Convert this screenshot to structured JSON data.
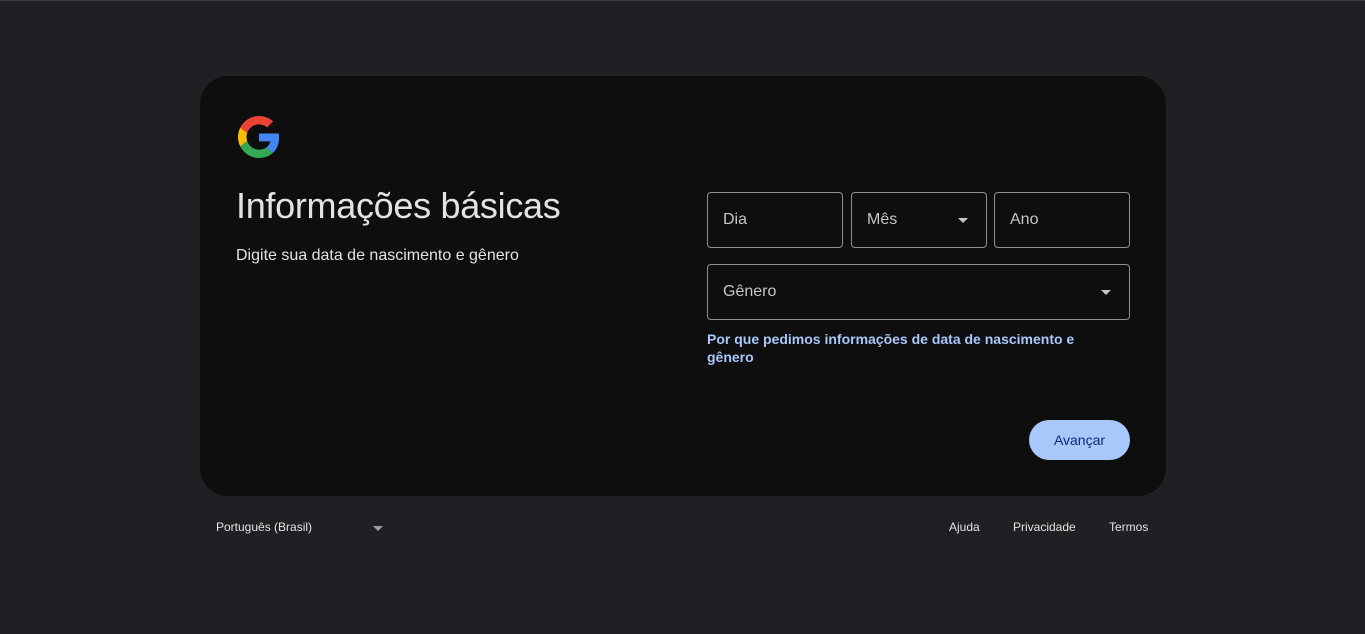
{
  "card": {
    "title": "Informações básicas",
    "subtitle": "Digite sua data de nascimento e gênero"
  },
  "form": {
    "day_placeholder": "Dia",
    "month_placeholder": "Mês",
    "year_placeholder": "Ano",
    "gender_placeholder": "Gênero",
    "why_link": "Por que pedimos informações de data de nascimento e gênero",
    "next_button": "Avançar"
  },
  "footer": {
    "language": "Português (Brasil)",
    "help": "Ajuda",
    "privacy": "Privacidade",
    "terms": "Termos"
  },
  "colors": {
    "background": "#1f2023",
    "card": "#0e0e0f",
    "accent": "#a8c7fa",
    "button_text": "#062e6f"
  }
}
